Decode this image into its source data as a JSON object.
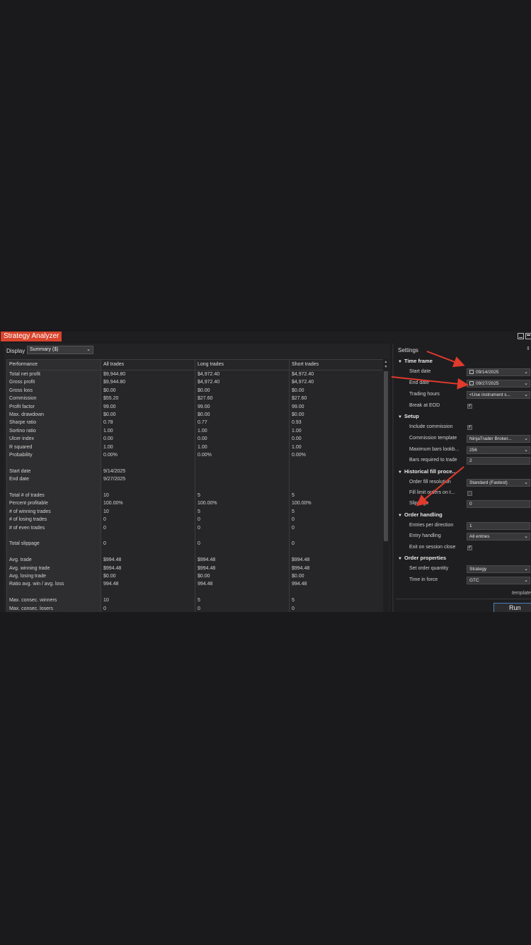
{
  "app": {
    "title": "Strategy Analyzer"
  },
  "display": {
    "label": "Display",
    "selected": "Summary ($)"
  },
  "table": {
    "headers": [
      "Performance",
      "All trades",
      "Long trades",
      "Short trades"
    ],
    "rows": [
      [
        "Total net profit",
        "$9,944.80",
        "$4,972.40",
        "$4,972.40"
      ],
      [
        "Gross profit",
        "$9,944.80",
        "$4,972.40",
        "$4,972.40"
      ],
      [
        "Gross loss",
        "$0.00",
        "$0.00",
        "$0.00"
      ],
      [
        "Commission",
        "$55.20",
        "$27.60",
        "$27.60"
      ],
      [
        "Profit factor",
        "99.00",
        "99.00",
        "99.00"
      ],
      [
        "Max. drawdown",
        "$0.00",
        "$0.00",
        "$0.00"
      ],
      [
        "Sharpe ratio",
        "0.78",
        "0.77",
        "0.93"
      ],
      [
        "Sortino ratio",
        "1.00",
        "1.00",
        "1.00"
      ],
      [
        "Ulcer index",
        "0.00",
        "0.00",
        "0.00"
      ],
      [
        "R squared",
        "1.00",
        "1.00",
        "1.00"
      ],
      [
        "Probability",
        "0.00%",
        "0.00%",
        "0.00%"
      ],
      [
        "",
        "",
        "",
        ""
      ],
      [
        "Start date",
        "9/14/2025",
        "",
        ""
      ],
      [
        "End date",
        "9/27/2025",
        "",
        ""
      ],
      [
        "",
        "",
        "",
        ""
      ],
      [
        "Total # of trades",
        "10",
        "5",
        "5"
      ],
      [
        "Percent profitable",
        "100.00%",
        "100.00%",
        "100.00%"
      ],
      [
        "# of winning trades",
        "10",
        "5",
        "5"
      ],
      [
        "# of losing trades",
        "0",
        "0",
        "0"
      ],
      [
        "# of even trades",
        "0",
        "0",
        "0"
      ],
      [
        "",
        "",
        "",
        ""
      ],
      [
        "Total slippage",
        "0",
        "0",
        "0"
      ],
      [
        "",
        "",
        "",
        ""
      ],
      [
        "Avg. trade",
        "$994.48",
        "$994.48",
        "$994.48"
      ],
      [
        "Avg. winning trade",
        "$994.48",
        "$994.48",
        "$994.48"
      ],
      [
        "Avg. losing trade",
        "$0.00",
        "$0.00",
        "$0.00"
      ],
      [
        "Ratio avg. win / avg. loss",
        "994.48",
        "994.48",
        "994.48"
      ],
      [
        "",
        "",
        "",
        ""
      ],
      [
        "Max. consec. winners",
        "10",
        "5",
        "5"
      ],
      [
        "Max. consec. losers",
        "0",
        "0",
        "0"
      ]
    ]
  },
  "settings": {
    "title": "Settings",
    "sections": [
      {
        "title": "Time frame",
        "items": [
          {
            "label": "Start date",
            "type": "date",
            "value": "09/14/2025"
          },
          {
            "label": "End date",
            "type": "date",
            "value": "09/27/2025"
          },
          {
            "label": "Trading hours",
            "type": "select",
            "value": "<Use instrument s..."
          },
          {
            "label": "Break at EOD",
            "type": "check",
            "checked": true
          }
        ]
      },
      {
        "title": "Setup",
        "items": [
          {
            "label": "Include commission",
            "type": "check",
            "checked": true
          },
          {
            "label": "Commission template",
            "type": "select",
            "value": "NinjaTrader Broker..."
          },
          {
            "label": "Maximum bars lookb...",
            "type": "select",
            "value": "256"
          },
          {
            "label": "Bars required to trade",
            "type": "text",
            "value": "2"
          }
        ]
      },
      {
        "title": "Historical fill proce...",
        "items": [
          {
            "label": "Order fill resolution",
            "type": "select",
            "value": "Standard (Fastest)"
          },
          {
            "label": "Fill limit orders on t...",
            "type": "check",
            "checked": false
          },
          {
            "label": "Slippage",
            "type": "text",
            "value": "0"
          }
        ]
      },
      {
        "title": "Order handling",
        "items": [
          {
            "label": "Entries per direction",
            "type": "text",
            "value": "1"
          },
          {
            "label": "Entry handling",
            "type": "select",
            "value": "All entries"
          },
          {
            "label": "Exit on session close",
            "type": "check",
            "checked": true
          }
        ]
      },
      {
        "title": "Order properties",
        "items": [
          {
            "label": "Set order quantity",
            "type": "select",
            "value": "Strategy"
          },
          {
            "label": "Time in force",
            "type": "select",
            "value": "GTC"
          }
        ]
      }
    ],
    "template_link": "template",
    "run_label": "Run"
  },
  "icons": {
    "dropdown": "chevron-down-icon",
    "calendar": "calendar-icon",
    "checkbox": "checkmark-icon",
    "section_toggle": "triangle-down-icon"
  },
  "colors": {
    "title_accent": "#d8452c",
    "annotation_arrow": "#e03a2c",
    "run_border": "#4d7fb8"
  }
}
